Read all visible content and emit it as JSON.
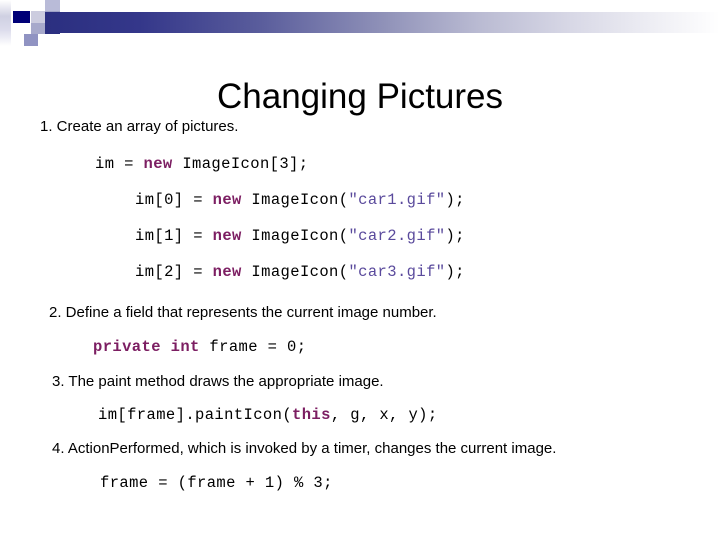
{
  "slide": {
    "title": "Changing Pictures",
    "theme": {
      "header_gradient_start": "#2b2f80",
      "header_gradient_end": "#ffffff",
      "accent_navy": "#000077",
      "accent_lavender": "#9fa2c6",
      "keyword_color": "#7c1e62",
      "string_color": "#5a4a9c",
      "text_color": "#000000",
      "background": "#ffffff"
    },
    "lines": {
      "step1": "1. Create an array of pictures.",
      "code_decl": {
        "pre": "im = ",
        "keyword": "new",
        "post": " ImageIcon[3];"
      },
      "code_assign_0": {
        "pre": "im[0] = ",
        "keyword": "new",
        "mid": " ImageIcon(",
        "string": "\"car1.gif\"",
        "post": ");"
      },
      "code_assign_1": {
        "pre": "im[1] = ",
        "keyword": "new",
        "mid": " ImageIcon(",
        "string": "\"car2.gif\"",
        "post": ");"
      },
      "code_assign_2": {
        "pre": "im[2] = ",
        "keyword": "new",
        "mid": " ImageIcon(",
        "string": "\"car3.gif\"",
        "post": ");"
      },
      "step2": "2. Define a field that represents the current image number.",
      "code_field": {
        "keyword": "private int",
        "post": " frame = 0;"
      },
      "step3": "3.  The paint method draws  the appropriate image.",
      "code_paint": {
        "pre": "im[frame].paintIcon(",
        "keyword": "this",
        "post": ", g, x, y);"
      },
      "step4": "4.  ActionPerformed, which is invoked by a timer,  changes the current image.",
      "code_frame": "frame = (frame + 1) % 3;"
    }
  }
}
